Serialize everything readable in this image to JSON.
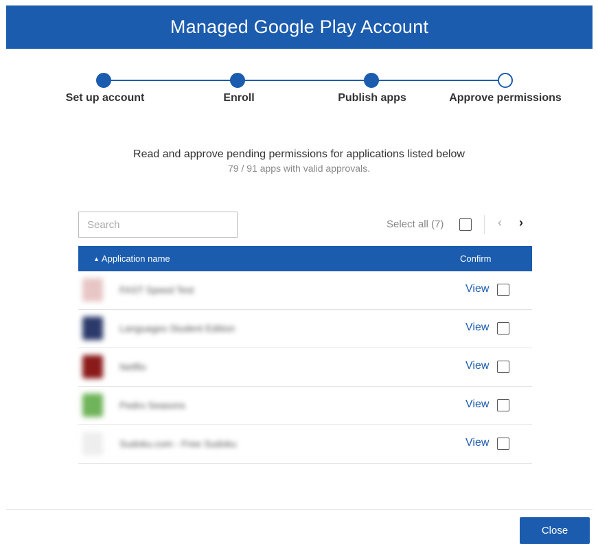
{
  "header": {
    "title": "Managed Google Play Account"
  },
  "stepper": {
    "steps": [
      {
        "label": "Set up account",
        "state": "complete"
      },
      {
        "label": "Enroll",
        "state": "complete"
      },
      {
        "label": "Publish apps",
        "state": "complete"
      },
      {
        "label": "Approve permissions",
        "state": "current"
      }
    ],
    "accent": "#1b5cae"
  },
  "intro": {
    "main": "Read and approve pending permissions for applications listed below",
    "sub": "79 / 91 apps with valid approvals."
  },
  "search": {
    "placeholder": "Search",
    "value": ""
  },
  "selection": {
    "select_all_label": "Select all (7)"
  },
  "pager": {
    "prev_icon": "chevron-left-icon",
    "next_icon": "chevron-right-icon"
  },
  "table": {
    "columns": {
      "name": "Application name",
      "confirm": "Confirm"
    },
    "rows": [
      {
        "name": "FAST Speed Test",
        "action": "View",
        "icon_color": "#e8c6c6"
      },
      {
        "name": "Languages Student Edition",
        "action": "View",
        "icon_color": "#2c3a6b"
      },
      {
        "name": "Netflix",
        "action": "View",
        "icon_color": "#8b1a1a"
      },
      {
        "name": "Pedro Seasons",
        "action": "View",
        "icon_color": "#6fb35a"
      },
      {
        "name": "Sudoku.com - Free Sudoku",
        "action": "View",
        "icon_color": "#f0f0f0"
      }
    ]
  },
  "footer": {
    "close_label": "Close"
  }
}
